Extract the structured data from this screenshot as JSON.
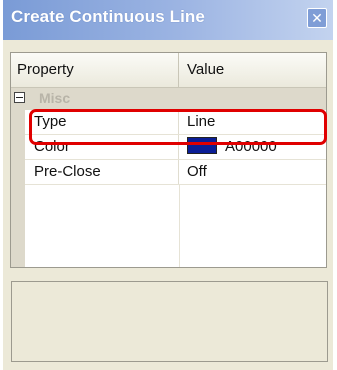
{
  "window": {
    "title": "Create Continuous Line",
    "close_glyph": "✕"
  },
  "grid": {
    "columns": [
      "Property",
      "Value"
    ],
    "category": "Misc",
    "rows": [
      {
        "name": "Type",
        "value": "Line"
      },
      {
        "name": "Color",
        "value": "A00000",
        "swatch": "#0b1e96"
      },
      {
        "name": "Pre-Close",
        "value": "Off"
      }
    ]
  },
  "annotation": {
    "color": "#e00000",
    "target": "Type"
  }
}
